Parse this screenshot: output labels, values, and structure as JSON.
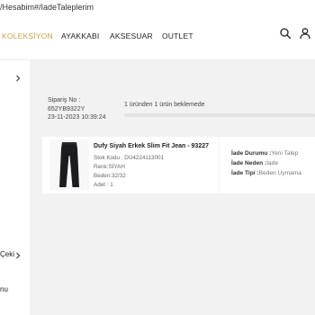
{
  "browser": {
    "url_fragment": "/Hesabim#/IadeTaleplerim"
  },
  "nav": {
    "items": [
      "KOLEKSİYON",
      "AYAKKABI",
      "AKSESUAR",
      "OUTLET"
    ],
    "icons": [
      "search-icon",
      "user-icon"
    ],
    "accent_color": "#c8a24a"
  },
  "sidebar": {
    "fragment_1": "Çeki",
    "fragment_2": "nu"
  },
  "order": {
    "label": "Sipariş No :",
    "number": "652YB9322Y",
    "date": "23-11-2023 10:39:24",
    "status": "1 üründen 1 ürün beklemede",
    "progress_fraction": 0
  },
  "product": {
    "name": "Dufy Siyah Erkek Slim Fit Jean - 93227",
    "stock_code": "Stok Kodu : DU4224113001",
    "color": "Renk:SİYAH",
    "size": "Beden:32/32",
    "quantity": "Adet : 1"
  },
  "return_request": {
    "status_label": "İade Durumu :",
    "status_value": "Yeni Talep",
    "reason_label": "İade Neden :",
    "reason_value": "İade",
    "type_label": "İade Tipi :",
    "type_value": "Beden Uymama"
  }
}
